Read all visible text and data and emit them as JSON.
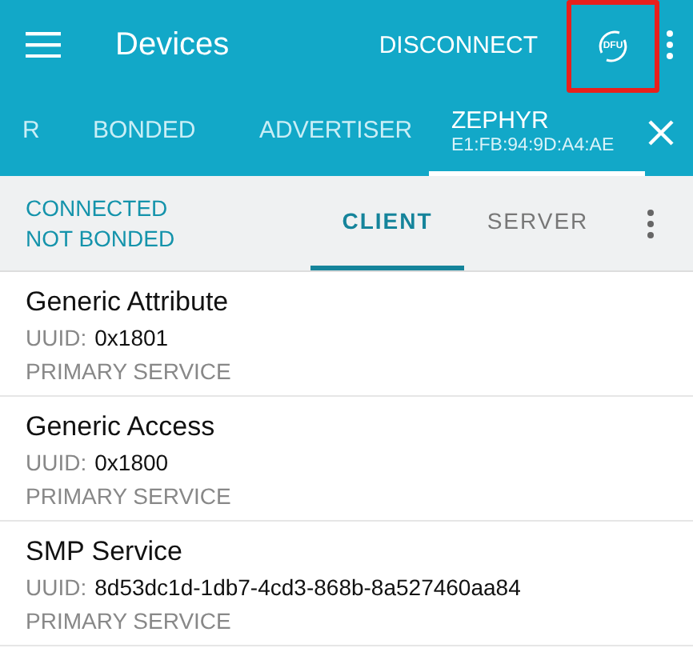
{
  "app_bar": {
    "title": "Devices",
    "action": "DISCONNECT",
    "dfu_label": "DFU",
    "dfu_highlighted": true
  },
  "tabs": [
    {
      "label": "R",
      "selected": false
    },
    {
      "label": "BONDED",
      "selected": false
    },
    {
      "label": "ADVERTISER",
      "selected": false
    },
    {
      "label": "ZEPHYR",
      "subtitle": "E1:FB:94:9D:A4:AE",
      "selected": true
    }
  ],
  "status": {
    "connection": "CONNECTED",
    "bond": "NOT BONDED"
  },
  "subtabs": [
    {
      "label": "CLIENT",
      "selected": true
    },
    {
      "label": "SERVER",
      "selected": false
    }
  ],
  "services": [
    {
      "name": "Generic Attribute",
      "uuid_label": "UUID:",
      "uuid": "0x1801",
      "type": "PRIMARY SERVICE"
    },
    {
      "name": "Generic Access",
      "uuid_label": "UUID:",
      "uuid": "0x1800",
      "type": "PRIMARY SERVICE"
    },
    {
      "name": "SMP Service",
      "uuid_label": "UUID:",
      "uuid": "8d53dc1d-1db7-4cd3-868b-8a527460aa84",
      "type": "PRIMARY SERVICE"
    }
  ]
}
